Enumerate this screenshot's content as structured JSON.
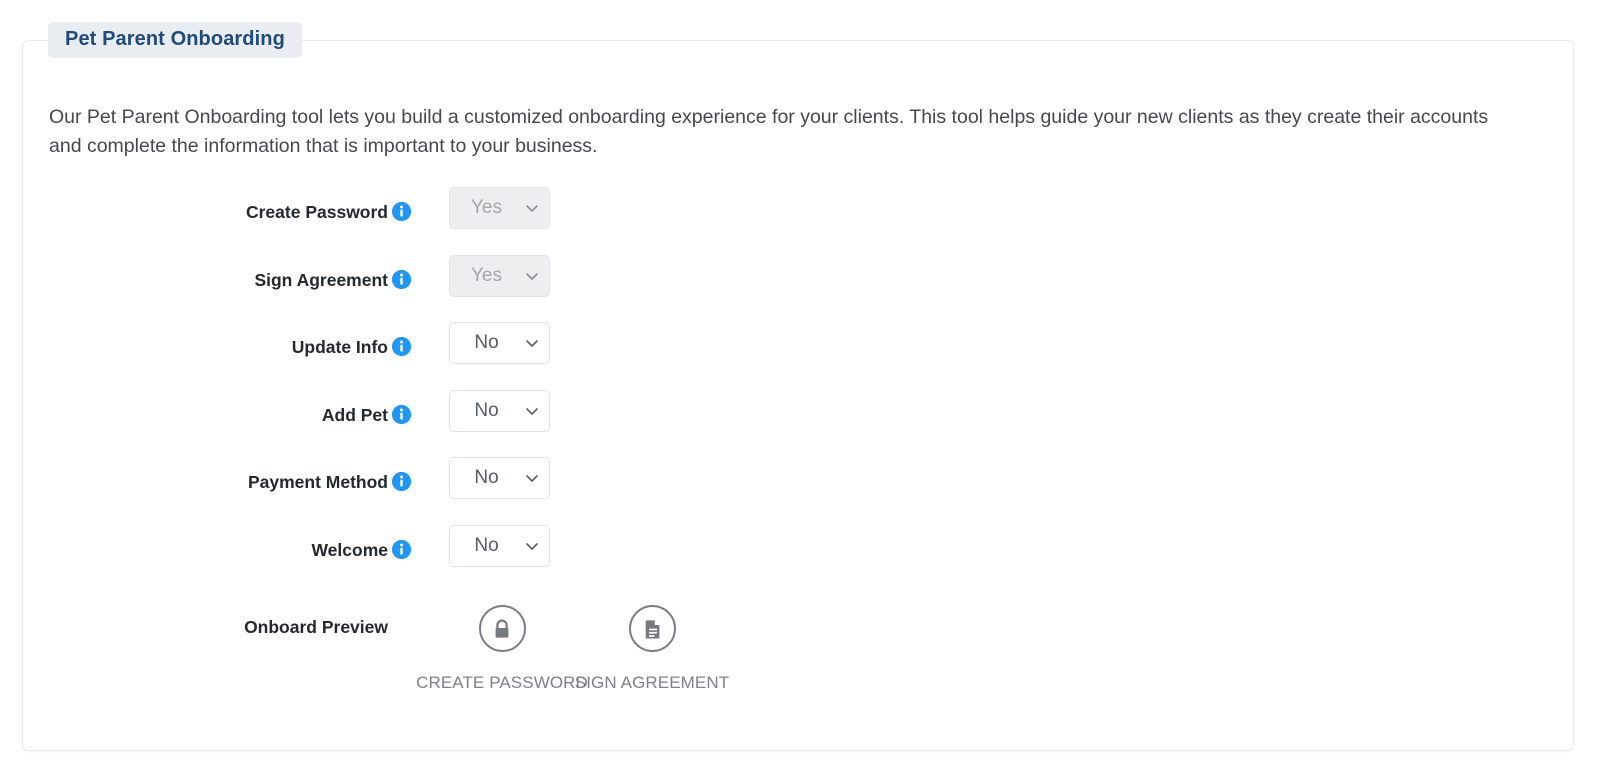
{
  "panel": {
    "title": "Pet Parent Onboarding",
    "intro": "Our Pet Parent Onboarding tool lets you build a customized onboarding experience for your clients. This tool helps guide your new clients as they create their accounts and complete the information that is important to your business."
  },
  "colors": {
    "title_text": "#1f4a7a",
    "title_background": "#e9edf2",
    "info_icon": "#2196f3",
    "panel_border": "#e8eaed",
    "disabled_select_background": "#eceef0",
    "caption_text": "#7d8289"
  },
  "form": {
    "rows": [
      {
        "label": "Create Password",
        "info_icon": "info-circle-icon",
        "value": "Yes",
        "disabled": true,
        "options": [
          "Yes",
          "No"
        ]
      },
      {
        "label": "Sign Agreement",
        "info_icon": "info-circle-icon",
        "value": "Yes",
        "disabled": true,
        "options": [
          "Yes",
          "No"
        ]
      },
      {
        "label": "Update Info",
        "info_icon": "info-circle-icon",
        "value": "No",
        "disabled": false,
        "options": [
          "Yes",
          "No"
        ]
      },
      {
        "label": "Add Pet",
        "info_icon": "info-circle-icon",
        "value": "No",
        "disabled": false,
        "options": [
          "Yes",
          "No"
        ]
      },
      {
        "label": "Payment Method",
        "info_icon": "info-circle-icon",
        "value": "No",
        "disabled": false,
        "options": [
          "Yes",
          "No"
        ]
      },
      {
        "label": "Welcome",
        "info_icon": "info-circle-icon",
        "value": "No",
        "disabled": false,
        "options": [
          "Yes",
          "No"
        ]
      }
    ]
  },
  "preview": {
    "label": "Onboard Preview",
    "items": [
      {
        "caption": "CREATE PASSWORD",
        "icon": "lock-icon"
      },
      {
        "caption": "SIGN AGREEMENT",
        "icon": "document-icon"
      }
    ]
  }
}
